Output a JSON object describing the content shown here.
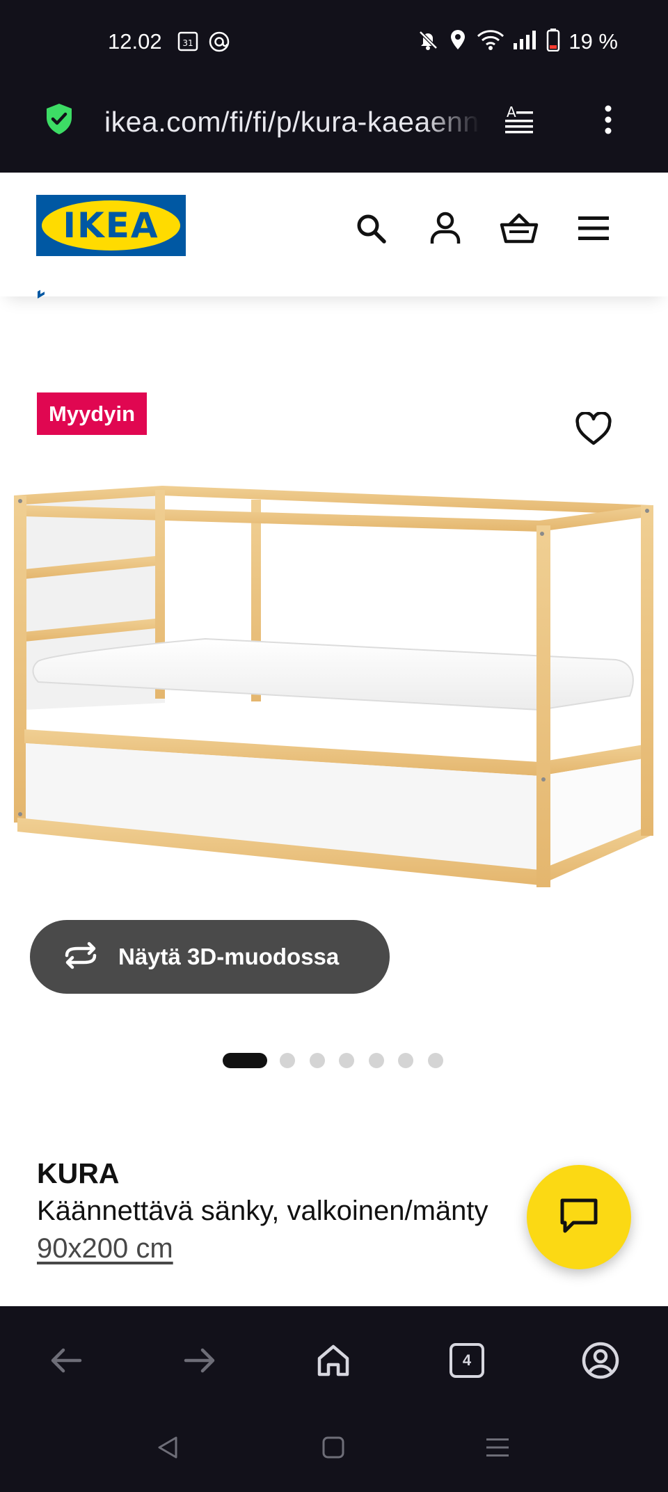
{
  "status_bar": {
    "time": "12.02",
    "calendar_day": "31",
    "battery_percent": "19 %"
  },
  "url_bar": {
    "url": "ikea.com/fi/fi/p/kura-kaeaennettaevae-saenky"
  },
  "header": {
    "logo_text": "IKEA"
  },
  "product": {
    "badge": "Myydyin",
    "view_3d_label": "Näytä 3D-muodossa",
    "image_count": 7,
    "active_image_index": 0,
    "name": "KURA",
    "description": "Käännettävä sänky, valkoinen/mänty",
    "size": "90x200 cm"
  },
  "browser_nav": {
    "tab_count": "4"
  },
  "colors": {
    "dark_bar": "#12111a",
    "ikea_blue": "#0058a3",
    "ikea_yellow": "#ffdb00",
    "badge_red": "#e00751",
    "chat_yellow": "#fbd914",
    "button_gray": "#4a4a4a"
  },
  "icons": {
    "status_left": [
      "calendar-icon",
      "threads-icon"
    ],
    "status_right": [
      "mute-icon",
      "location-icon",
      "wifi-icon",
      "signal-icon",
      "battery-icon"
    ],
    "header": [
      "search-icon",
      "profile-icon",
      "basket-icon",
      "menu-icon"
    ],
    "browser_nav": [
      "back-icon",
      "forward-icon",
      "home-icon",
      "tabs-icon",
      "account-icon"
    ],
    "system_nav": [
      "system-back-icon",
      "system-home-icon",
      "system-recents-icon"
    ]
  }
}
